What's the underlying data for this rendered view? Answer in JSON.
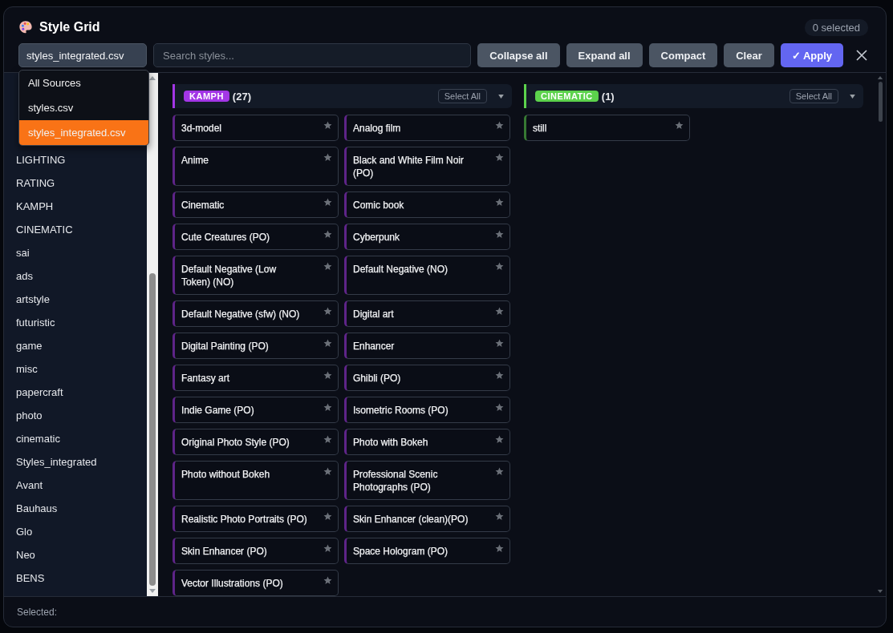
{
  "window": {
    "title": "Style Grid",
    "selected_count": "0 selected"
  },
  "toolbar": {
    "source": "styles_integrated.csv",
    "search": {
      "placeholder": "Search styles..."
    },
    "buttons": [
      {
        "label": "Collapse all",
        "kind": "plain"
      },
      {
        "label": "Expand all",
        "kind": "plain"
      },
      {
        "label": "Compact",
        "kind": "plain"
      },
      {
        "label": "Clear",
        "kind": "plain"
      },
      {
        "label": "✓ Apply",
        "kind": "primary"
      }
    ]
  },
  "source_dropdown": [
    {
      "label": "All Sources",
      "selected": false
    },
    {
      "label": "styles.csv",
      "selected": false
    },
    {
      "label": "styles_integrated.csv",
      "selected": true
    }
  ],
  "sidebar": {
    "items": [
      "LIGHTING",
      "RATING",
      "KAMPH",
      "CINEMATIC",
      "sai",
      "ads",
      "artstyle",
      "futuristic",
      "game",
      "misc",
      "papercraft",
      "photo",
      "cinematic",
      "Styles_integrated",
      "Avant",
      "Bauhaus",
      "Glo",
      "Neo",
      "BENS"
    ]
  },
  "groups": [
    {
      "name": "KAMPH",
      "count": "(27)",
      "color": "#a336e6",
      "select_all": "Select All",
      "styles": [
        "3d-model",
        "Analog film",
        "Anime",
        "Black and White Film Noir (PO)",
        "Cinematic",
        "Comic book",
        "Cute Creatures (PO)",
        "Cyberpunk",
        "Default Negative (Low Token) (NO)",
        "Default Negative (NO)",
        "Default Negative (sfw) (NO)",
        "Digital art",
        "Digital Painting (PO)",
        "Enhancer",
        "Fantasy art",
        "Ghibli (PO)",
        "Indie Game (PO)",
        "Isometric Rooms (PO)",
        "Original Photo Style (PO)",
        "Photo with Bokeh",
        "Photo without Bokeh",
        "Professional Scenic Photographs (PO)",
        "Realistic Photo Portraits (PO)",
        "Skin Enhancer (clean)(PO)",
        "Skin Enhancer (PO)",
        "Space Hologram (PO)",
        "Vector Illustrations (PO)"
      ]
    },
    {
      "name": "CINEMATIC",
      "count": "(1)",
      "color": "#5cd24c",
      "select_all": "Select All",
      "styles": [
        "still"
      ]
    }
  ],
  "footer": {
    "label": "Selected:"
  }
}
